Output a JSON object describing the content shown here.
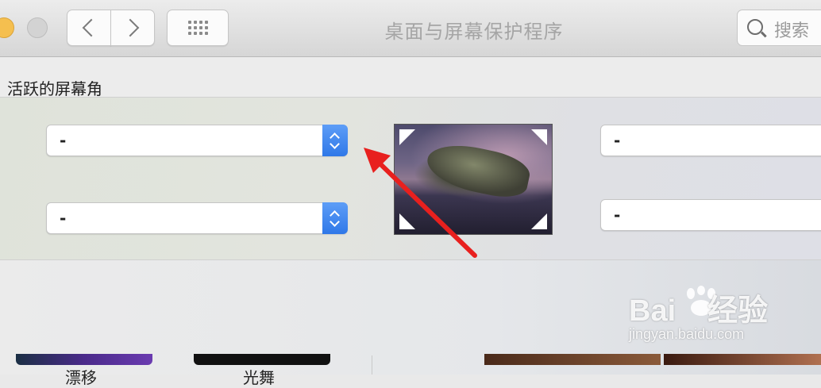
{
  "window": {
    "title": "桌面与屏幕保护程序"
  },
  "toolbar": {
    "search_placeholder": "搜索"
  },
  "hot_corners": {
    "section_title": "活跃的屏幕角",
    "top_left_value": "-",
    "bottom_left_value": "-",
    "top_right_value": "-",
    "bottom_right_value": "-"
  },
  "screensaver_thumbnails": [
    {
      "label": "漂移"
    },
    {
      "label": "光舞"
    }
  ],
  "watermark": {
    "brand": "Bai",
    "brand2": "经验",
    "url": "jingyan.baidu.com"
  },
  "colors": {
    "accent": "#2f78e8",
    "arrow": "#e8201e"
  }
}
